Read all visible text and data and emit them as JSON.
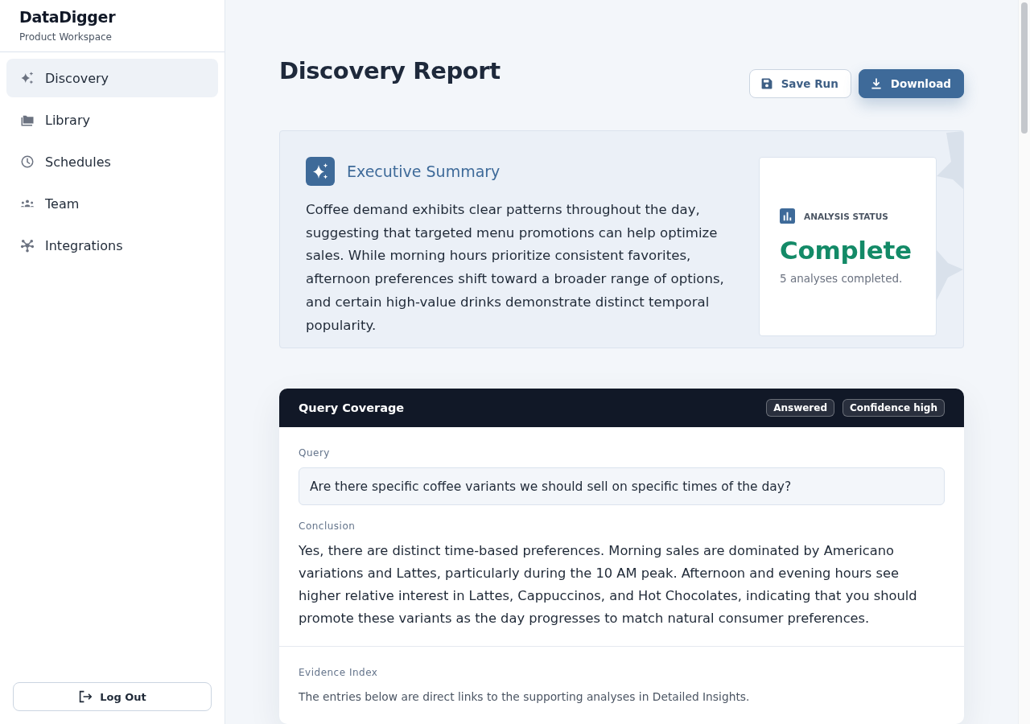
{
  "sidebar": {
    "brand": "DataDigger",
    "subtitle": "Product Workspace",
    "items": [
      {
        "label": "Discovery",
        "selected": true
      },
      {
        "label": "Library",
        "selected": false
      },
      {
        "label": "Schedules",
        "selected": false
      },
      {
        "label": "Team",
        "selected": false
      },
      {
        "label": "Integrations",
        "selected": false
      }
    ],
    "logout": "Log Out"
  },
  "header": {
    "title": "Discovery Report",
    "buttons": [
      {
        "label": "Save Run",
        "kind": "outline"
      },
      {
        "label": "Download",
        "kind": "primary"
      }
    ]
  },
  "summary": {
    "heading": "Executive Summary",
    "text": "Coffee demand exhibits clear patterns throughout the day, suggesting that targeted menu promotions can help optimize sales. While morning hours prioritize consistent favorites, afternoon preferences shift toward a broader range of options, and certain high-value drinks demonstrate distinct temporal popularity.",
    "status": {
      "label": "ANALYSIS STATUS",
      "value": "Complete",
      "note": "5 analyses completed."
    }
  },
  "query_coverage": {
    "title": "Query Coverage",
    "badges": [
      "Answered",
      "Confidence high"
    ],
    "query_label": "Query",
    "query": "Are there specific coffee variants we should sell on specific times of the day?",
    "conclusion_label": "Conclusion",
    "conclusion": "Yes, there are distinct time-based preferences. Morning sales are dominated by Americano variations and Lattes, particularly during the 10 AM peak. Afternoon and evening hours see higher relative interest in Lattes, Cappuccinos, and Hot Chocolates, indicating that you should promote these variants as the day progresses to match natural consumer preferences.",
    "evidence_label": "Evidence Index",
    "evidence_text": "The entries below are direct links to the supporting analyses in Detailed Insights."
  }
}
